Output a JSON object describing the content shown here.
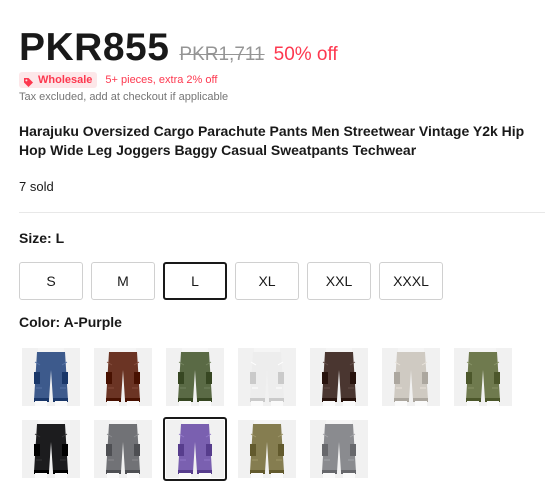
{
  "price": {
    "current": "PKR855",
    "original": "PKR1,711",
    "discount": "50% off"
  },
  "wholesale": {
    "badge": "Wholesale",
    "text": "5+ pieces, extra 2% off",
    "icon": "tag-icon"
  },
  "tax_note": "Tax excluded, add at checkout if applicable",
  "title": "Harajuku Oversized Cargo Parachute Pants Men Streetwear Vintage Y2k Hip Hop Wide Leg Joggers Baggy Casual Sweatpants Techwear",
  "sold": "7 sold",
  "size": {
    "label": "Size: ",
    "selected": "L",
    "options": [
      "S",
      "M",
      "L",
      "XL",
      "XXL",
      "XXXL"
    ]
  },
  "color": {
    "label": "Color: ",
    "selected": "A-Purple",
    "swatches": [
      {
        "color": "#3d5a8c"
      },
      {
        "color": "#6b3424"
      },
      {
        "color": "#5a6a45"
      },
      {
        "color": "#ededed"
      },
      {
        "color": "#4a3630"
      },
      {
        "color": "#cfcac2"
      },
      {
        "color": "#6f7a4e"
      },
      {
        "color": "#1c1c1e"
      },
      {
        "color": "#717276"
      },
      {
        "color": "#7a60b0"
      },
      {
        "color": "#857d50"
      },
      {
        "color": "#8a8b8f"
      }
    ]
  },
  "colors": {
    "accent_red": "#fd384f",
    "badge_bg": "#fde7e9",
    "text": "#191919",
    "muted": "#757575",
    "strike": "#959595"
  }
}
